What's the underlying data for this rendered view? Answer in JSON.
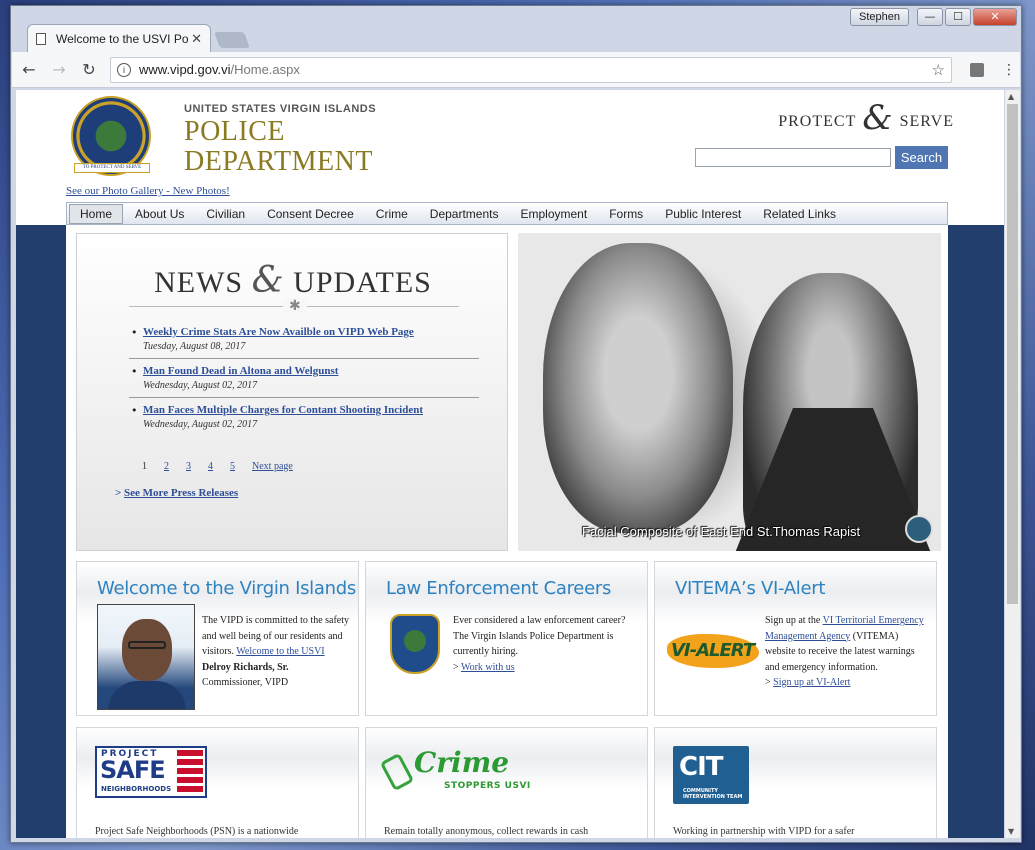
{
  "window": {
    "user": "Stephen",
    "minimize": "—",
    "maximize": "☐",
    "close": "✕"
  },
  "tab": {
    "title": "Welcome to the USVI Po",
    "close": "✕"
  },
  "toolbar": {
    "back": "←",
    "forward": "→",
    "reload": "↻",
    "url_host": "www.vipd.gov.vi",
    "url_path": "/Home.aspx",
    "star": "☆",
    "menu": "⋮"
  },
  "header": {
    "org_top": "UNITED STATES VIRGIN ISLANDS",
    "org_line1": "POLICE",
    "org_line2": "DEPARTMENT",
    "tag_left": "PROTECT",
    "tag_amp": "&",
    "tag_right": "SERVE",
    "search_button": "Search",
    "gallery_link": "See our Photo Gallery - New Photos!",
    "seal_ribbon": "TO PROTECT AND SERVE"
  },
  "nav": [
    "Home",
    "About Us",
    "Civilian",
    "Consent Decree",
    "Crime",
    "Departments",
    "Employment",
    "Forms",
    "Public Interest",
    "Related Links"
  ],
  "news": {
    "title_left": "NEWS",
    "title_amp": "&",
    "title_right": "UPDATES",
    "items": [
      {
        "headline": "Weekly Crime Stats Are Now Availble on VIPD Web Page",
        "date": "Tuesday, August 08, 2017"
      },
      {
        "headline": "Man Found Dead in Altona and Welgunst",
        "date": "Wednesday, August 02, 2017"
      },
      {
        "headline": "Man Faces Multiple Charges for Contant Shooting Incident",
        "date": "Wednesday, August 02, 2017"
      }
    ],
    "pages": [
      "1",
      "2",
      "3",
      "4",
      "5"
    ],
    "next_page": "Next page",
    "more_prefix": "> ",
    "more_link": "See More Press Releases"
  },
  "feature": {
    "caption": "Facial Composite of East End St.Thomas Rapist"
  },
  "cards": {
    "welcome": {
      "title": "Welcome to the Virgin Islands",
      "text1": "The VIPD is committed to the safety and well being of our residents and visitors.",
      "link": "Welcome to the USVI",
      "name": "Delroy Richards, Sr.",
      "role": "Commissioner, VIPD"
    },
    "careers": {
      "title": "Law Enforcement Careers",
      "text": "Ever considered a law enforcement career? The Virgin Islands Police Department is currently hiring.",
      "link_prefix": "> ",
      "link": "Work with us"
    },
    "vitema": {
      "title": "VITEMA’s VI-Alert",
      "logo": "VI-ALERT",
      "text1": "Sign up at the ",
      "link1": "VI Territorial Emergency Management Agency",
      "text2": " (VITEMA) website to receive the latest warnings and emergency information.",
      "link_prefix": "> ",
      "link2": "Sign up at VI-Alert"
    }
  },
  "lower": {
    "psn": {
      "l1": "PROJECT",
      "l2": "SAFE",
      "l3": "NEIGHBORHOODS",
      "text": "Project Safe Neighborhoods (PSN) is a nationwide"
    },
    "crime": {
      "word": "Crime",
      "sub": "STOPPERS USVI",
      "text": "Remain totally anonymous, collect rewards in cash"
    },
    "cit": {
      "logo": "CIT",
      "sub": "COMMUNITY INTERVENTION TEAM",
      "text": "Working in partnership with VIPD for a safer"
    }
  },
  "colors": {
    "accent": "#2d82bf",
    "link": "#2e4f98",
    "gold": "#8a7a22",
    "navy": "#223e6d",
    "button": "#4f76b3"
  }
}
